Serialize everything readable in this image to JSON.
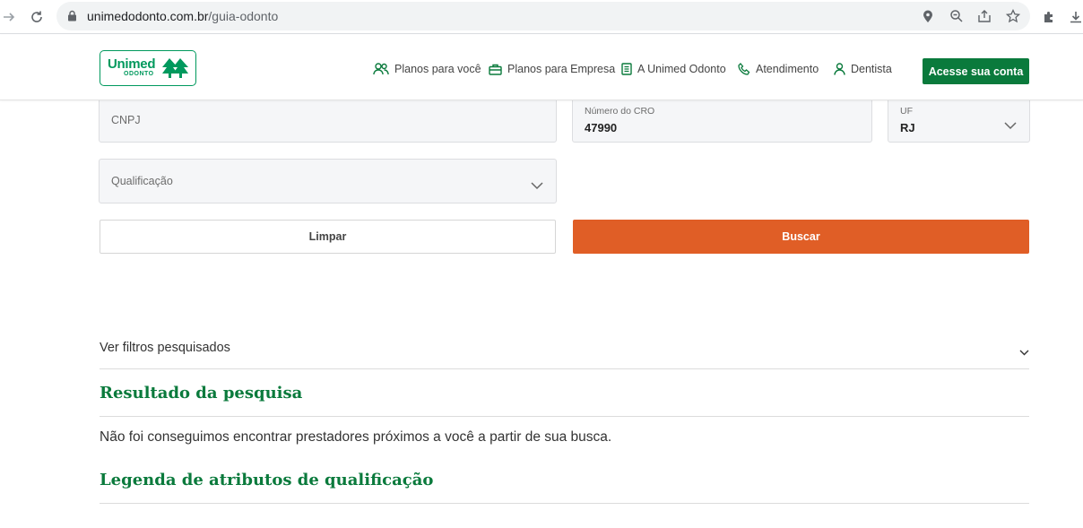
{
  "browser": {
    "url_host": "unimedodonto.com.br",
    "url_path": "/guia-odonto"
  },
  "header": {
    "logo_brand": "Unimed",
    "logo_sub": "ODONTO",
    "menu": [
      {
        "label": "Planos para você",
        "icon": "people-icon"
      },
      {
        "label": "Planos para Empresa",
        "icon": "briefcase-icon"
      },
      {
        "label": "A Unimed Odonto",
        "icon": "document-icon"
      },
      {
        "label": "Atendimento",
        "icon": "phone-icon"
      },
      {
        "label": "Dentista",
        "icon": "person-icon"
      }
    ],
    "cta_label": "Acesse sua conta"
  },
  "form": {
    "cnpj_placeholder": "CNPJ",
    "cro_label": "Número do CRO",
    "cro_value": "47990",
    "uf_label": "UF",
    "uf_value": "RJ",
    "qualificacao_placeholder": "Qualificação",
    "clear_label": "Limpar",
    "search_label": "Buscar"
  },
  "results": {
    "filters_label": "Ver filtros pesquisados",
    "title": "Resultado da pesquisa",
    "message": "Não foi conseguimos encontrar prestadores próximos a você a partir de sua busca.",
    "legend_title": "Legenda de atributos de qualificação"
  },
  "colors": {
    "brand_green": "#0a7a3c",
    "accent_orange": "#e05e26"
  }
}
